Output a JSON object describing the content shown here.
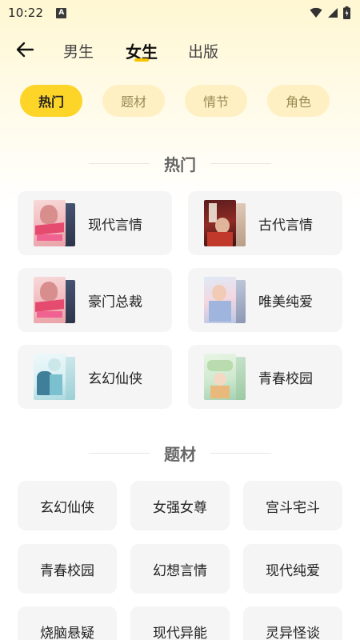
{
  "status_bar": {
    "time": "10:22",
    "notification_badge": "A"
  },
  "nav": {
    "tabs": [
      {
        "label": "男生"
      },
      {
        "label": "女生"
      },
      {
        "label": "出版"
      }
    ],
    "active_tab": "女生"
  },
  "filters": [
    {
      "label": "热门"
    },
    {
      "label": "题材"
    },
    {
      "label": "情节"
    },
    {
      "label": "角色"
    }
  ],
  "hot_section": {
    "title": "热门",
    "items": [
      {
        "label": "现代言情"
      },
      {
        "label": "古代言情"
      },
      {
        "label": "豪门总裁"
      },
      {
        "label": "唯美纯爱"
      },
      {
        "label": "玄幻仙侠"
      },
      {
        "label": "青春校园"
      }
    ]
  },
  "theme_section": {
    "title": "题材",
    "items": [
      {
        "label": "玄幻仙侠"
      },
      {
        "label": "女强女尊"
      },
      {
        "label": "宫斗宅斗"
      },
      {
        "label": "青春校园"
      },
      {
        "label": "幻想言情"
      },
      {
        "label": "现代纯爱"
      },
      {
        "label": "烧脑悬疑"
      },
      {
        "label": "现代异能"
      },
      {
        "label": "灵异怪谈"
      }
    ]
  },
  "colors": {
    "accent": "#fdd428",
    "pill_inactive": "#fff0c4",
    "card_bg": "#f5f5f6"
  }
}
